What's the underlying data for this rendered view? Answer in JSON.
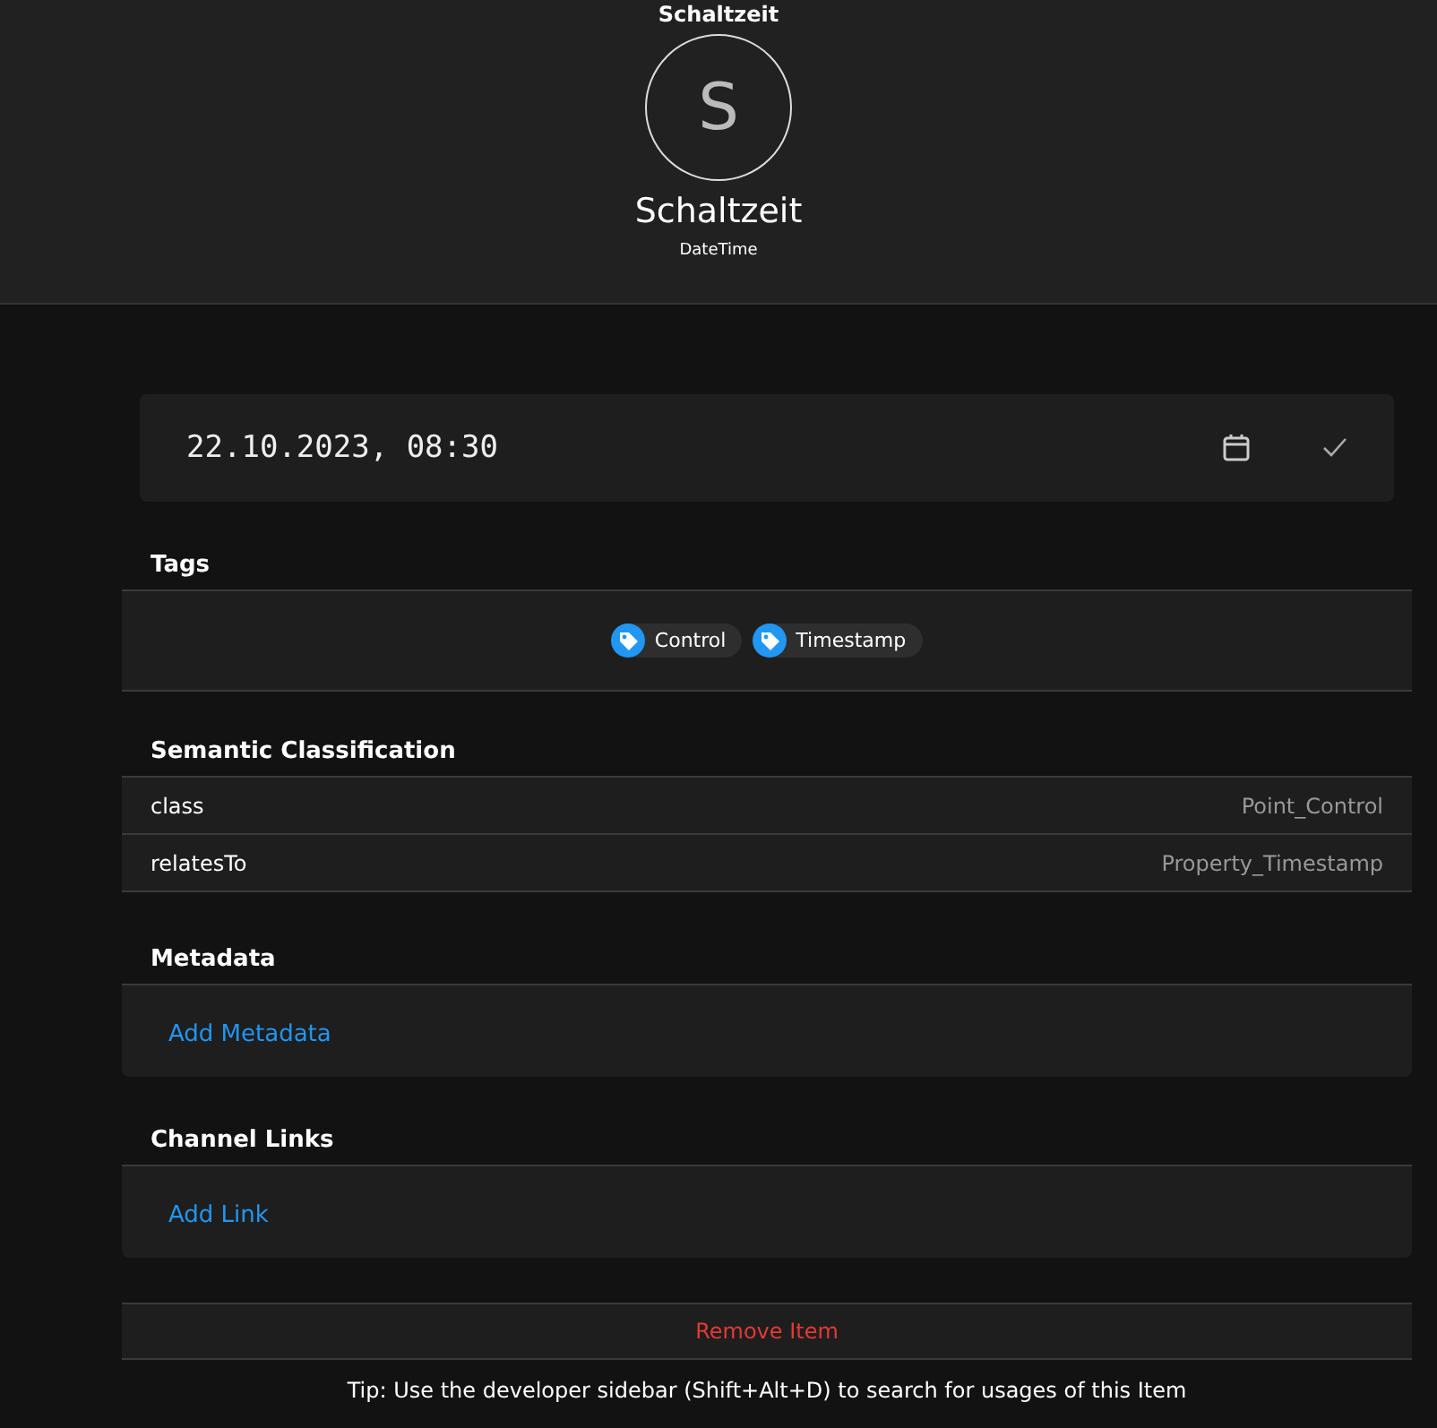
{
  "header": {
    "title": "Schaltzeit",
    "avatar_letter": "S",
    "name": "Schaltzeit",
    "type": "DateTime"
  },
  "date_field": {
    "value": "22.10.2023, 08:30"
  },
  "tags": {
    "heading": "Tags",
    "items": [
      "Control",
      "Timestamp"
    ]
  },
  "semantic": {
    "heading": "Semantic Classification",
    "rows": [
      {
        "key": "class",
        "value": "Point_Control"
      },
      {
        "key": "relatesTo",
        "value": "Property_Timestamp"
      }
    ]
  },
  "metadata": {
    "heading": "Metadata",
    "link": "Add Metadata"
  },
  "channel_links": {
    "heading": "Channel Links",
    "link": "Add Link"
  },
  "remove_button": "Remove Item",
  "tip": "Tip: Use the developer sidebar (Shift+Alt+D) to search for usages of this Item"
}
